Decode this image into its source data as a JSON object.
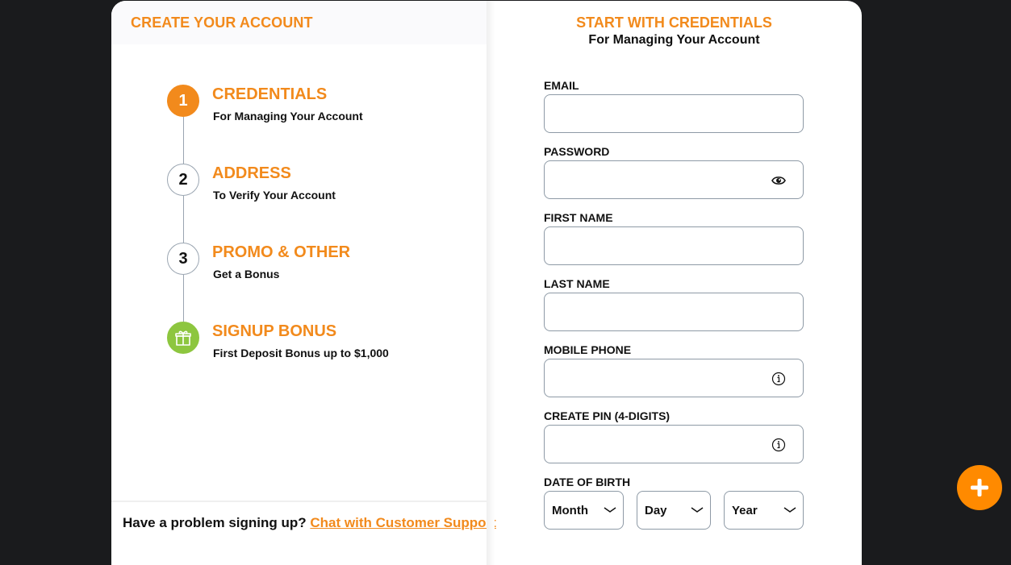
{
  "left_panel": {
    "header_title": "CREATE YOUR ACCOUNT",
    "steps": [
      {
        "marker": "1",
        "title": "CREDENTIALS",
        "subtitle": "For Managing Your Account",
        "state": "active"
      },
      {
        "marker": "2",
        "title": "ADDRESS",
        "subtitle": "To Verify Your Account",
        "state": "pending"
      },
      {
        "marker": "3",
        "title": "PROMO & OTHER",
        "subtitle": "Get a Bonus",
        "state": "pending"
      },
      {
        "marker": "gift-icon",
        "title": "SIGNUP BONUS",
        "subtitle": "First Deposit Bonus up to $1,000",
        "state": "bonus"
      }
    ],
    "footer_text": "Have a problem signing up?",
    "footer_link": "Chat with Customer Support"
  },
  "right_panel": {
    "title": "START WITH CREDENTIALS",
    "subtitle": "For Managing Your Account",
    "fields": {
      "email": {
        "label": "EMAIL",
        "value": "",
        "placeholder": ""
      },
      "password": {
        "label": "PASSWORD",
        "value": "",
        "placeholder": "",
        "icon": "eye-icon"
      },
      "first_name": {
        "label": "FIRST NAME",
        "value": "",
        "placeholder": ""
      },
      "last_name": {
        "label": "LAST NAME",
        "value": "",
        "placeholder": ""
      },
      "mobile_phone": {
        "label": "MOBILE PHONE",
        "value": "",
        "placeholder": "",
        "icon": "info-icon"
      },
      "pin": {
        "label": "CREATE PIN (4-DIGITS)",
        "value": "",
        "placeholder": "",
        "icon": "info-icon"
      }
    },
    "date_of_birth": {
      "label": "DATE OF BIRTH",
      "month": "Month",
      "day": "Day",
      "year": "Year"
    }
  },
  "fab": {
    "icon": "plus-icon"
  },
  "colors": {
    "accent": "#f28a1c",
    "fab": "#ff8a00",
    "bonus_green": "#8dc63f",
    "background": "#1a1b1d"
  }
}
